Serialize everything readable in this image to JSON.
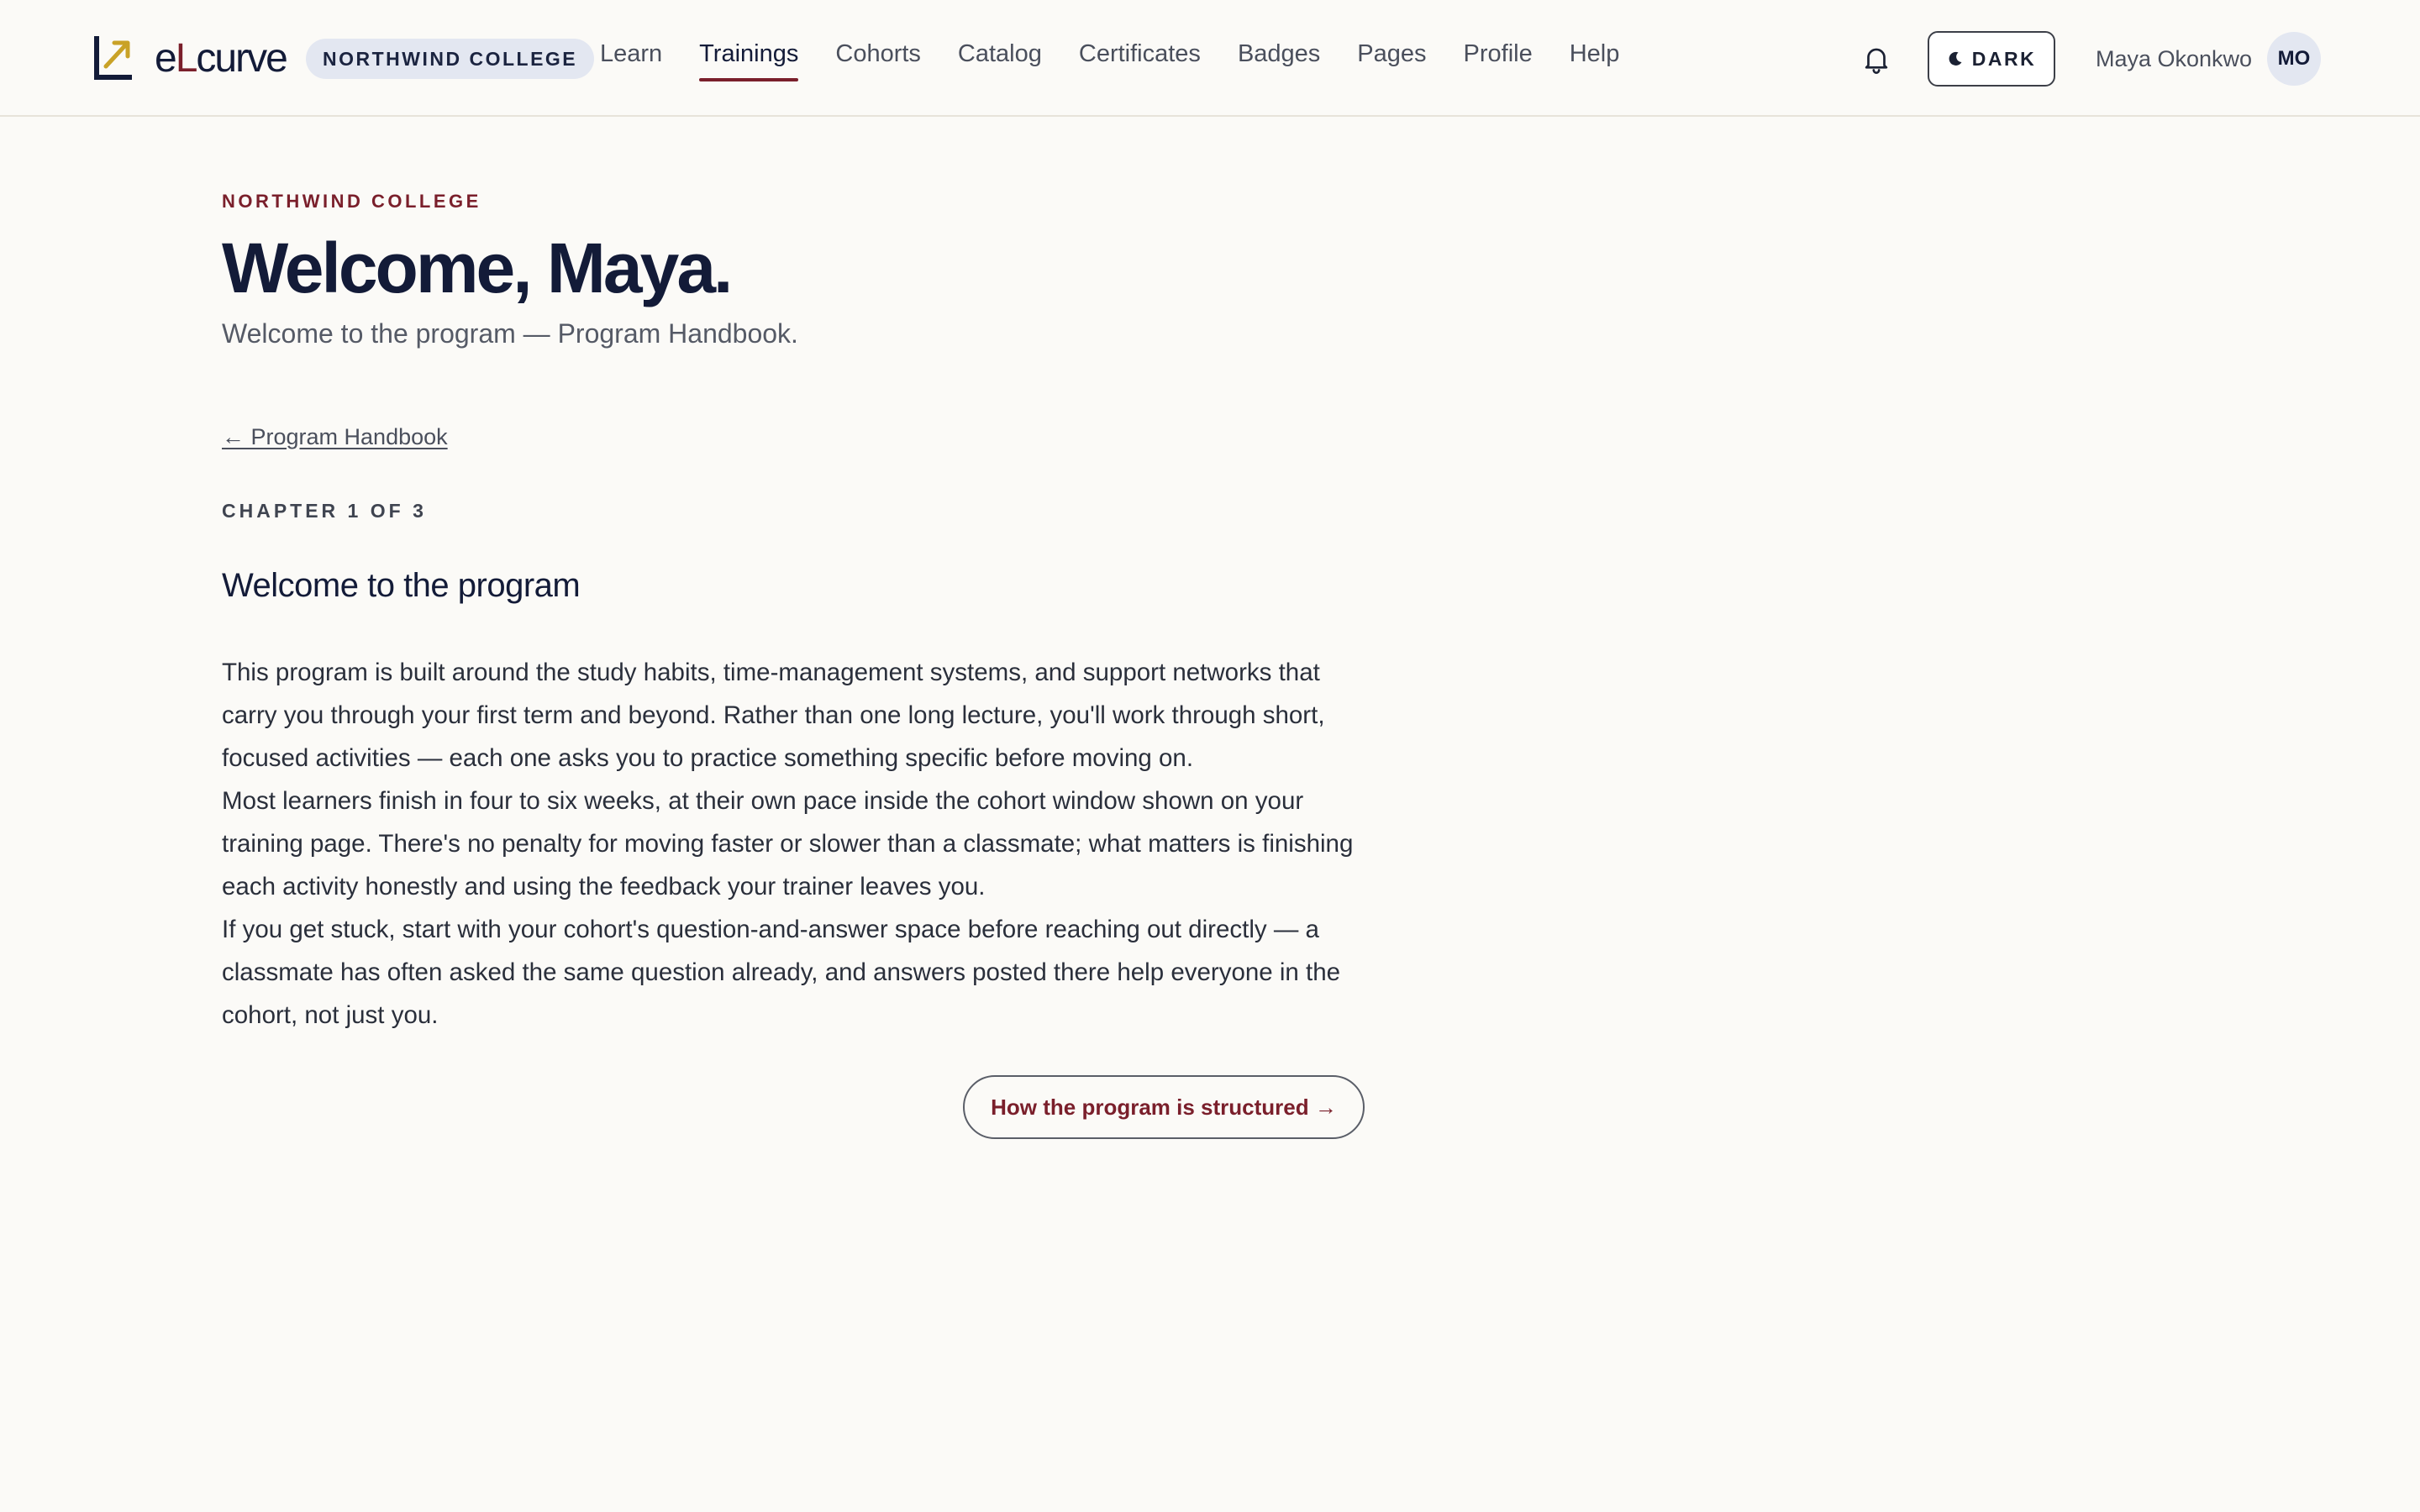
{
  "header": {
    "brand_prefix": "e",
    "brand_accent": "L",
    "brand_suffix": "curve",
    "org_badge": "NORTHWIND COLLEGE",
    "nav": [
      {
        "label": "Learn",
        "active": false
      },
      {
        "label": "Trainings",
        "active": true
      },
      {
        "label": "Cohorts",
        "active": false
      },
      {
        "label": "Catalog",
        "active": false
      },
      {
        "label": "Certificates",
        "active": false
      },
      {
        "label": "Badges",
        "active": false
      },
      {
        "label": "Pages",
        "active": false
      },
      {
        "label": "Profile",
        "active": false
      },
      {
        "label": "Help",
        "active": false
      }
    ],
    "notifications_icon": "bell-icon",
    "theme_toggle_label": "DARK",
    "theme_toggle_icon": "moon-icon",
    "user_name": "Maya Okonkwo",
    "user_initials": "MO"
  },
  "page": {
    "eyebrow": "NORTHWIND COLLEGE",
    "title": "Welcome, Maya.",
    "subtitle": "Welcome to the program — Program Handbook."
  },
  "chapter": {
    "back_link": "← Program Handbook",
    "meta": "CHAPTER 1 OF 3",
    "title": "Welcome to the program",
    "paragraphs": [
      "This program is built around the study habits, time-management systems, and support networks that carry you through your first term and beyond. Rather than one long lecture, you'll work through short, focused activities — each one asks you to practice something specific before moving on.",
      "Most learners finish in four to six weeks, at their own pace inside the cohort window shown on your training page. There's no penalty for moving faster or slower than a classmate; what matters is finishing each activity honestly and using the feedback your trainer leaves you.",
      "If you get stuck, start with your cohort's question-and-answer space before reaching out directly — a classmate has often asked the same question already, and answers posted there help everyone in the cohort, not just you."
    ],
    "next_button": "How the program is structured →"
  },
  "colors": {
    "accent": "#7a1f2b",
    "navy": "#131b38",
    "logo_gold": "#c9a227",
    "background": "#fbfaf7",
    "pill_bg": "#e3e7f1"
  }
}
